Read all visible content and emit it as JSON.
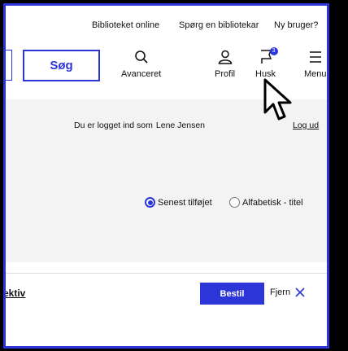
{
  "header": {
    "links": [
      "Biblioteket online",
      "Spørg en bibliotekar",
      "Ny bruger?"
    ],
    "search_button": "Søg",
    "nav": {
      "advanced": "Avanceret",
      "profile": "Profil",
      "remember": "Husk",
      "remember_count": "3",
      "menu": "Menu"
    }
  },
  "account": {
    "logged_in_label": "Du er logget ind som",
    "user_name": "Lene Jensen",
    "logout": "Log ud"
  },
  "sort": {
    "options": [
      "Senest tilføjet",
      "Alfabetisk - titel"
    ],
    "selected": "Senest tilføjet"
  },
  "list_item": {
    "title_fragment": "ektiv",
    "order_button": "Bestil",
    "remove_label": "Fjern"
  },
  "colors": {
    "accent": "#2b35d8",
    "band": "#f3f3f3"
  }
}
